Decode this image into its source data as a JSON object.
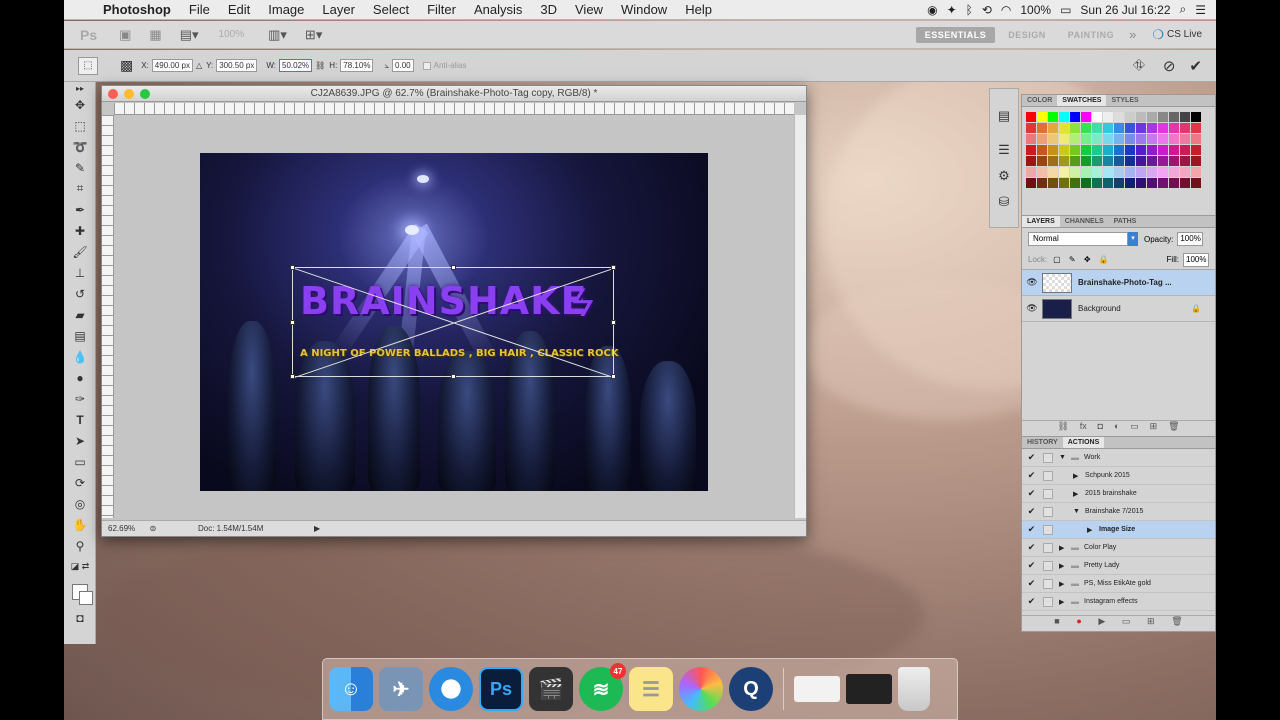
{
  "menubar": {
    "app_name": "Photoshop",
    "items": [
      "File",
      "Edit",
      "Image",
      "Layer",
      "Select",
      "Filter",
      "Analysis",
      "3D",
      "View",
      "Window",
      "Help"
    ],
    "battery": "100%",
    "clock": "Sun 26 Jul  16:22"
  },
  "appbar": {
    "logo": "Ps",
    "zoom": "100%",
    "workspaces": [
      "ESSENTIALS",
      "DESIGN",
      "PAINTING"
    ],
    "more": "»",
    "cs_live": "CS Live"
  },
  "options": {
    "x": "490.00 px",
    "y": "300.50 px",
    "w": "50.02%",
    "h": "78.10%",
    "angle": "0.00",
    "antialias": "Anti-alias"
  },
  "document": {
    "title": "CJ2A8639.JPG @ 62.7% (Brainshake-Photo-Tag copy, RGB/8) *",
    "brand_text": "BRAINSHAKE",
    "bolt": "ϟ",
    "tagline": "A NIGHT OF POWER BALLADS , BIG HAIR , CLASSIC ROCK",
    "zoom": "62.69%",
    "doc_size": "Doc: 1.54M/1.54M"
  },
  "swatches_panel": {
    "tabs": [
      "COLOR",
      "SWATCHES",
      "STYLES"
    ],
    "active": "SWATCHES"
  },
  "layers_panel": {
    "tabs": [
      "LAYERS",
      "CHANNELS",
      "PATHS"
    ],
    "blend_mode": "Normal",
    "opacity_label": "Opacity:",
    "opacity": "100%",
    "lock_label": "Lock:",
    "fill_label": "Fill:",
    "fill": "100%",
    "layers": [
      {
        "name": "Brainshake-Photo-Tag ...",
        "selected": true
      },
      {
        "name": "Background",
        "selected": false
      }
    ]
  },
  "actions_panel": {
    "tabs": [
      "HISTORY",
      "ACTIONS"
    ],
    "items": [
      {
        "label": "Work",
        "indent": 0
      },
      {
        "label": "Schpunk 2015",
        "indent": 1
      },
      {
        "label": "2015 brainshake",
        "indent": 1
      },
      {
        "label": "Brainshake 7/2015",
        "indent": 1
      },
      {
        "label": "Image Size",
        "indent": 2
      },
      {
        "label": "Color Play",
        "indent": 0
      },
      {
        "label": "Pretty Lady",
        "indent": 0
      },
      {
        "label": "PS, Miss EtikAte gold",
        "indent": 0
      },
      {
        "label": "Instagram effects",
        "indent": 0
      }
    ]
  },
  "dock": {
    "spotify_badge": "47"
  },
  "colors": {
    "accent_select": "#b8d2ef",
    "brand_purple": "#8a3ff0",
    "tagline_gold": "#e6c43a"
  }
}
